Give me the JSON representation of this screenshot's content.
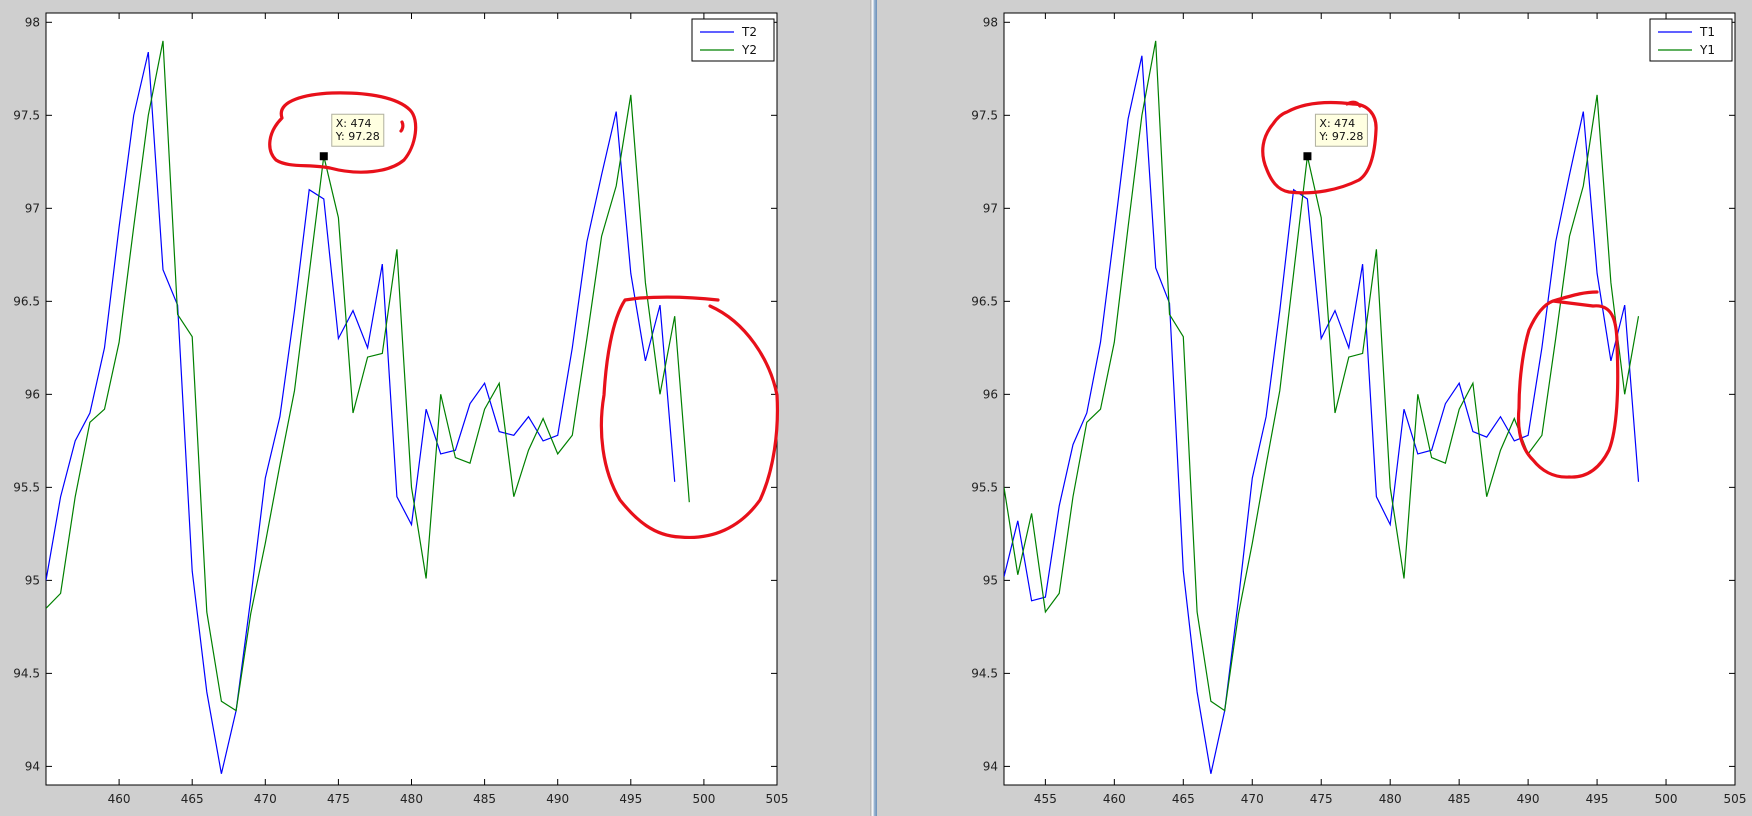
{
  "window": {
    "accent": "#6a8fb8",
    "figure_bg": "#cfcfcf"
  },
  "chart_data": [
    {
      "type": "line",
      "xlim": [
        455,
        505
      ],
      "ylim": [
        93.9,
        98.05
      ],
      "xticks": [
        460,
        465,
        470,
        475,
        480,
        485,
        490,
        495,
        500,
        505
      ],
      "yticks": [
        94,
        94.5,
        95,
        95.5,
        96,
        96.5,
        97,
        97.5,
        98
      ],
      "legend_position": "top-right",
      "grid": false,
      "series": [
        {
          "name": "T2",
          "color": "#0000ff",
          "x": [
            455,
            456,
            457,
            458,
            459,
            460,
            461,
            462,
            463,
            464,
            465,
            466,
            467,
            468,
            469,
            470,
            471,
            472,
            473,
            474,
            475,
            476,
            477,
            478,
            479,
            480,
            481,
            482,
            483,
            484,
            485,
            486,
            487,
            488,
            489,
            490,
            491,
            492,
            493,
            494,
            495,
            496,
            497,
            498
          ],
          "y": [
            95.0,
            95.45,
            95.75,
            95.9,
            96.25,
            96.9,
            97.5,
            97.84,
            96.67,
            96.48,
            95.05,
            94.4,
            93.96,
            94.3,
            94.9,
            95.55,
            95.88,
            96.45,
            97.1,
            97.05,
            96.3,
            96.45,
            96.25,
            96.7,
            95.45,
            95.3,
            95.92,
            95.68,
            95.7,
            95.95,
            96.06,
            95.8,
            95.78,
            95.88,
            95.75,
            95.78,
            96.25,
            96.82,
            97.18,
            97.52,
            96.65,
            96.18,
            96.48,
            95.53
          ]
        },
        {
          "name": "Y2",
          "color": "#008000",
          "x": [
            455,
            456,
            457,
            458,
            459,
            460,
            461,
            462,
            463,
            464,
            465,
            466,
            467,
            468,
            469,
            470,
            471,
            472,
            473,
            474,
            475,
            476,
            477,
            478,
            479,
            480,
            481,
            482,
            483,
            484,
            485,
            486,
            487,
            488,
            489,
            490,
            491,
            492,
            493,
            494,
            495,
            496,
            497,
            498,
            499
          ],
          "y": [
            94.85,
            94.93,
            95.45,
            95.85,
            95.92,
            96.28,
            96.9,
            97.5,
            97.9,
            96.43,
            96.31,
            94.83,
            94.35,
            94.3,
            94.82,
            95.2,
            95.62,
            96.02,
            96.65,
            97.28,
            96.95,
            95.9,
            96.2,
            96.22,
            96.78,
            95.5,
            95.01,
            96.0,
            95.66,
            95.63,
            95.92,
            96.06,
            95.45,
            95.7,
            95.87,
            95.68,
            95.78,
            96.3,
            96.85,
            97.12,
            97.61,
            96.6,
            96.0,
            96.42,
            95.42
          ]
        }
      ],
      "datatip": {
        "x_text": "X: 474",
        "y_text": "Y: 97.28",
        "x": 474,
        "y": 97.28
      }
    },
    {
      "type": "line",
      "xlim": [
        452,
        505
      ],
      "ylim": [
        93.9,
        98.05
      ],
      "xticks": [
        455,
        460,
        465,
        470,
        475,
        480,
        485,
        490,
        495,
        500,
        505
      ],
      "yticks": [
        94,
        94.5,
        95,
        95.5,
        96,
        96.5,
        97,
        97.5,
        98
      ],
      "legend_position": "top-right",
      "grid": false,
      "series": [
        {
          "name": "T1",
          "color": "#0000ff",
          "x": [
            452,
            453,
            454,
            455,
            456,
            457,
            458,
            459,
            460,
            461,
            462,
            463,
            464,
            465,
            466,
            467,
            468,
            469,
            470,
            471,
            472,
            473,
            474,
            475,
            476,
            477,
            478,
            479,
            480,
            481,
            482,
            483,
            484,
            485,
            486,
            487,
            488,
            489,
            490,
            491,
            492,
            493,
            494,
            495,
            496,
            497,
            498
          ],
          "y": [
            95.02,
            95.32,
            94.89,
            94.91,
            95.4,
            95.73,
            95.9,
            96.28,
            96.87,
            97.48,
            97.82,
            96.68,
            96.49,
            95.05,
            94.4,
            93.96,
            94.3,
            94.9,
            95.55,
            95.88,
            96.45,
            97.1,
            97.05,
            96.3,
            96.45,
            96.25,
            96.7,
            95.45,
            95.3,
            95.92,
            95.68,
            95.7,
            95.95,
            96.06,
            95.8,
            95.77,
            95.88,
            95.75,
            95.78,
            96.25,
            96.82,
            97.18,
            97.52,
            96.65,
            96.18,
            96.48,
            95.53
          ]
        },
        {
          "name": "Y1",
          "color": "#008000",
          "x": [
            452,
            453,
            454,
            455,
            456,
            457,
            458,
            459,
            460,
            461,
            462,
            463,
            464,
            465,
            466,
            467,
            468,
            469,
            470,
            471,
            472,
            473,
            474,
            475,
            476,
            477,
            478,
            479,
            480,
            481,
            482,
            483,
            484,
            485,
            486,
            487,
            488,
            489,
            490,
            491,
            492,
            493,
            494,
            495,
            496,
            497,
            498
          ],
          "y": [
            95.5,
            95.03,
            95.36,
            94.83,
            94.93,
            95.45,
            95.85,
            95.92,
            96.28,
            96.9,
            97.5,
            97.9,
            96.43,
            96.31,
            94.83,
            94.35,
            94.3,
            94.82,
            95.2,
            95.62,
            96.02,
            96.65,
            97.28,
            96.95,
            95.9,
            96.2,
            96.22,
            96.78,
            95.5,
            95.01,
            96.0,
            95.66,
            95.63,
            95.92,
            96.06,
            95.45,
            95.7,
            95.87,
            95.68,
            95.78,
            96.3,
            96.85,
            97.12,
            97.61,
            96.6,
            96.0,
            96.42
          ]
        }
      ],
      "datatip": {
        "x_text": "X: 474",
        "y_text": "Y: 97.28",
        "x": 474,
        "y": 97.28
      }
    }
  ]
}
